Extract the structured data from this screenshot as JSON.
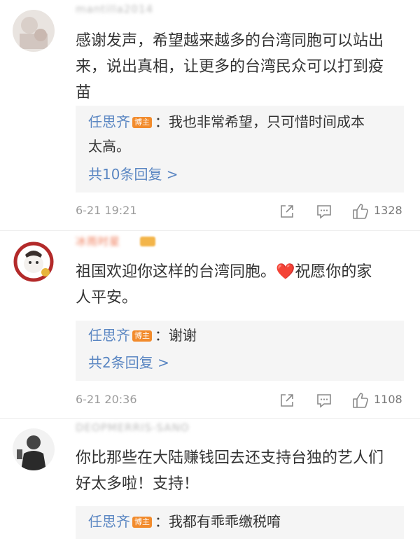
{
  "comments": [
    {
      "username": "mantilla2014",
      "text_line1": "感谢发声，希望越来越多的台湾同胞可以站出",
      "text_line2": "来，说出真相，让更多的台湾民众可以打到疫",
      "text_line3": "苗",
      "reply": {
        "author": "任思齐",
        "tag": "博主",
        "sep": "：",
        "text_line1": "我也非常希望，只可惜时间成本",
        "text_line2": "太高。"
      },
      "reply_count": "共10条回复 >",
      "time": "6-21 19:21",
      "likes": "1328"
    },
    {
      "username": "冰雨时星",
      "text_line1": "祖国欢迎你这样的台湾同胞。❤️祝愿你的家",
      "text_line2": "人平安。",
      "reply": {
        "author": "任思齐",
        "tag": "博主",
        "sep": "：",
        "text_line1": "谢谢"
      },
      "reply_count": "共2条回复 >",
      "time": "6-21 20:36",
      "likes": "1108"
    },
    {
      "username": "DEOPMERRIS-SANO",
      "text_line1": "你比那些在大陆赚钱回去还支持台独的艺人们",
      "text_line2": "好太多啦！支持！",
      "reply": {
        "author": "任思齐",
        "tag": "博主",
        "sep": "：",
        "text_line1": "我都有乖乖缴税唷"
      }
    }
  ],
  "icons": {
    "share": "share-icon",
    "comment": "comment-icon",
    "like": "thumbs-up-icon"
  },
  "colors": {
    "author_link": "#5a86c2",
    "tag_bg": "#f28b2c",
    "reply_bg": "#f5f5f5"
  }
}
